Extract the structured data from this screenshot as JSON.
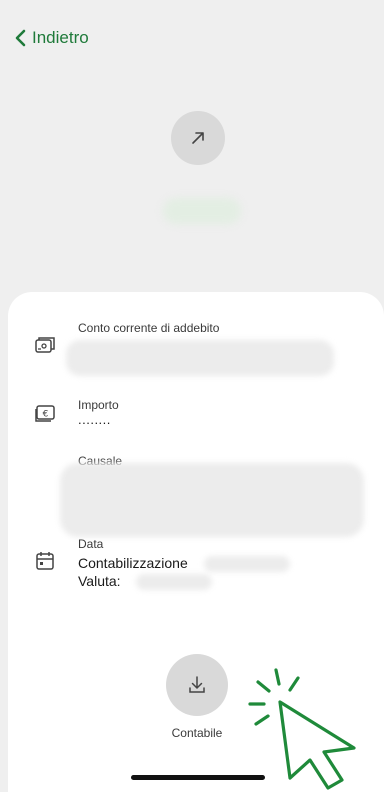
{
  "header": {
    "back_label": "Indietro"
  },
  "details": {
    "account_label": "Conto corrente di addebito",
    "amount_label": "Importo",
    "amount_value": "........",
    "reason_label": "Causale",
    "date_label": "Data",
    "booking_label": "Contabilizzazione",
    "value_label": "Valuta:"
  },
  "actions": {
    "download_label": "Contabile"
  },
  "colors": {
    "accent": "#1f7a3a",
    "background": "#efefef",
    "sheet": "#ffffff"
  },
  "icons": [
    "chevron-left-icon",
    "arrow-up-right-icon",
    "bank-card-icon",
    "euro-bill-icon",
    "calendar-icon",
    "download-icon",
    "cursor-click-icon"
  ]
}
